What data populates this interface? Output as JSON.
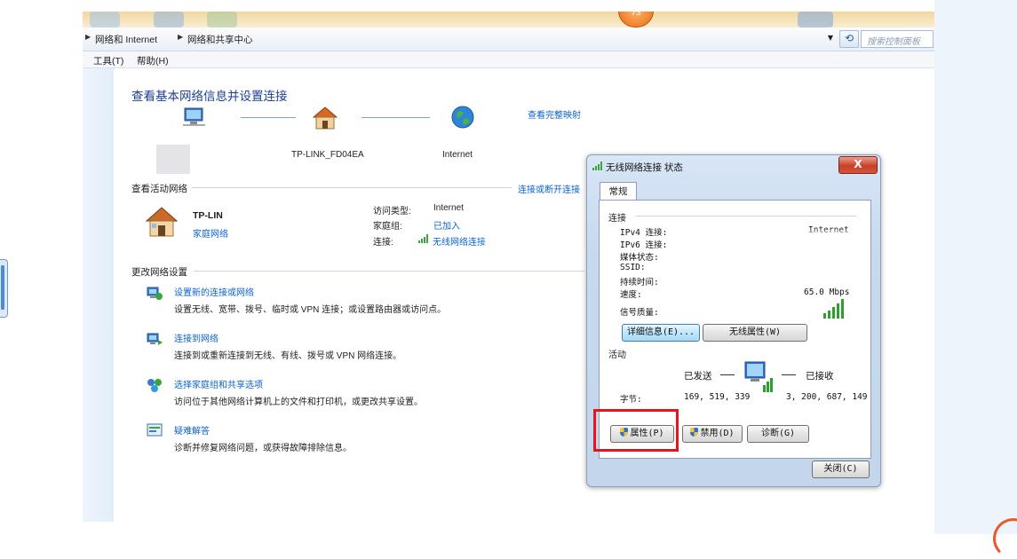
{
  "breadcrumb": {
    "items": [
      "网络和 Internet",
      "网络和共享中心"
    ]
  },
  "search": {
    "placeholder": "搜索控制面板"
  },
  "menu": {
    "items": [
      "工具(T)",
      "帮助(H)"
    ]
  },
  "main": {
    "title": "查看基本网络信息并设置连接",
    "map_link": "查看完整映射",
    "map": {
      "router_label": "TP-LINK_FD04EA",
      "internet_label": "Internet"
    },
    "active_networks": {
      "header": "查看活动网络",
      "connect_link": "连接或断开连接",
      "network_name": "TP-LIN",
      "network_type": "家庭网络",
      "access_type_label": "访问类型:",
      "access_type_value": "Internet",
      "homegroup_label": "家庭组:",
      "homegroup_value": "已加入",
      "connections_label": "连接:",
      "connections_value": "无线网络连接"
    },
    "change_settings": {
      "header": "更改网络设置",
      "items": [
        {
          "title": "设置新的连接或网络",
          "desc": "设置无线、宽带、拨号、临时或 VPN 连接；或设置路由器或访问点。",
          "icon": "new-connection-icon"
        },
        {
          "title": "连接到网络",
          "desc": "连接到或重新连接到无线、有线、拨号或 VPN 网络连接。",
          "icon": "connect-network-icon"
        },
        {
          "title": "选择家庭组和共享选项",
          "desc": "访问位于其他网络计算机上的文件和打印机，或更改共享设置。",
          "icon": "homegroup-icon"
        },
        {
          "title": "疑难解答",
          "desc": "诊断并修复网络问题，或获得故障排除信息。",
          "icon": "troubleshoot-icon"
        }
      ]
    }
  },
  "dialog": {
    "title": "无线网络连接 状态",
    "close": "X",
    "tab": "常规",
    "connection_header": "连接",
    "rows": [
      {
        "label": "IPv4 连接:",
        "value": "Internet"
      },
      {
        "label": "IPv6 连接:",
        "value": ""
      },
      {
        "label": "媒体状态:",
        "value": ""
      },
      {
        "label": "SSID:",
        "value": ""
      },
      {
        "label": "持续时间:",
        "value": ""
      },
      {
        "label": "速度:",
        "value": "65.0 Mbps"
      }
    ],
    "signal_label": "信号质量:",
    "details_button": "详细信息(E)...",
    "wireless_props_button": "无线属性(W)",
    "activity_header": "活动",
    "sent_label": "已发送",
    "received_label": "已接收",
    "bytes_label": "字节:",
    "bytes_sent": "169, 519, 339",
    "bytes_received": "3, 200, 687, 149",
    "properties_button": "属性(P)",
    "disable_button": "禁用(D)",
    "diagnose_button": "诊断(G)",
    "close_button": "关闭(C)"
  },
  "colors": {
    "link": "#0b62cb",
    "heading": "#1b3f91",
    "highlight": "#e8141c"
  }
}
